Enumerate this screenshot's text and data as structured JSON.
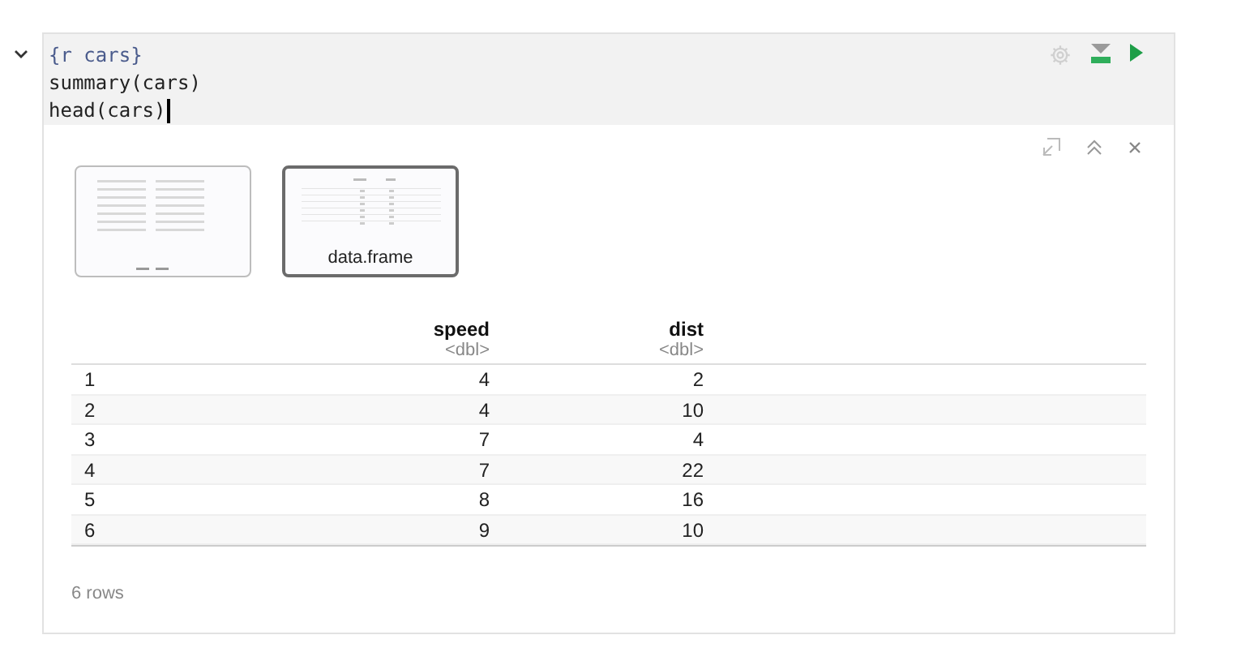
{
  "chunk": {
    "expanded": true,
    "code_lines": [
      {
        "kind": "header",
        "text": "{r cars}"
      },
      {
        "kind": "code",
        "text": "summary(cars)"
      },
      {
        "kind": "code",
        "text": "head(cars)",
        "cursor": true
      }
    ],
    "output": {
      "thumbnails": [
        {
          "kind": "text",
          "selected": false
        },
        {
          "kind": "table",
          "label": "data.frame",
          "selected": true
        }
      ],
      "table": {
        "columns": [
          {},
          {
            "name": "speed",
            "type": "<dbl>"
          },
          {
            "name": "dist",
            "type": "<dbl>"
          }
        ],
        "rows": [
          [
            "1",
            "4",
            "2"
          ],
          [
            "2",
            "4",
            "10"
          ],
          [
            "3",
            "7",
            "4"
          ],
          [
            "4",
            "7",
            "22"
          ],
          [
            "5",
            "8",
            "16"
          ],
          [
            "6",
            "9",
            "10"
          ]
        ],
        "footer": "6 rows"
      }
    }
  }
}
